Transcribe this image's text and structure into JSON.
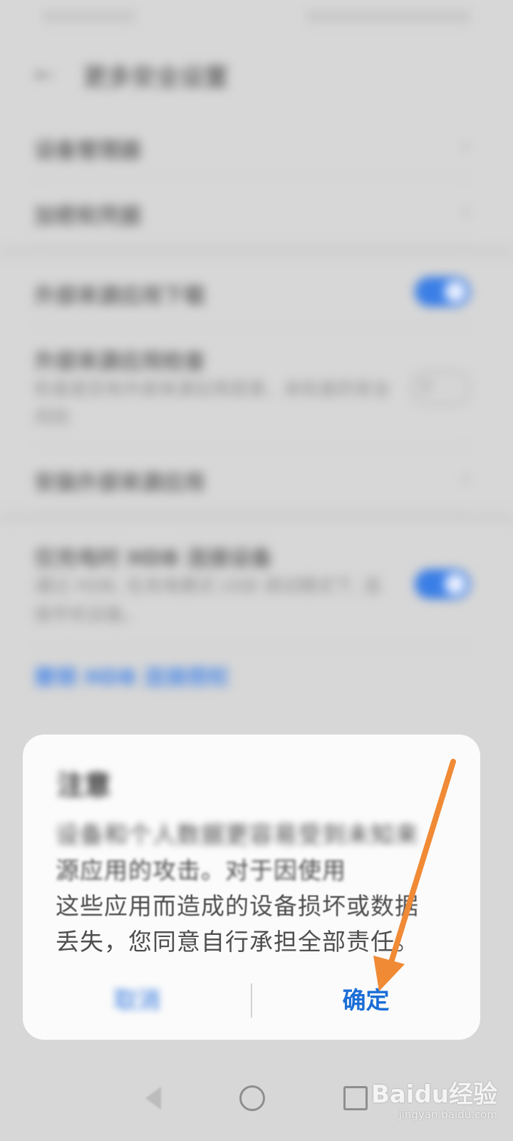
{
  "settings_screen": {
    "title": "更多安全设置",
    "rows": [
      {
        "title": "设备管理器"
      },
      {
        "title": "加密和凭据"
      },
      {
        "title": "外部来源应用下载",
        "toggle": "on"
      },
      {
        "title": "外部来源应用检查",
        "desc": "检查是否有外部来源应用恶意、未检查的安全风险",
        "toggle": "off"
      },
      {
        "title": "安装外部来源应用"
      },
      {
        "title": "仅充电时 HDB 连接设备",
        "desc": "通过 HDB, 在充电模式 USB 调试模式下, 连接手机设备。",
        "toggle": "on"
      }
    ],
    "link": "撤销 HDB 连接授权"
  },
  "dialog": {
    "title": "注意",
    "body_line1": "设备和个人数据更容易受到未知来",
    "body_line2": "源应用的攻击。对于因使用",
    "body_line3": "这些应用而造成的设备损坏或数据",
    "body_line4": "丢失，您同意自行承担全部责任。",
    "cancel_label": "取消",
    "confirm_label": "确定"
  },
  "annotation": {
    "arrow_color": "#f08a35"
  },
  "watermark": {
    "logo": "Baidu经验",
    "site": "jingyan.baidu.com"
  }
}
